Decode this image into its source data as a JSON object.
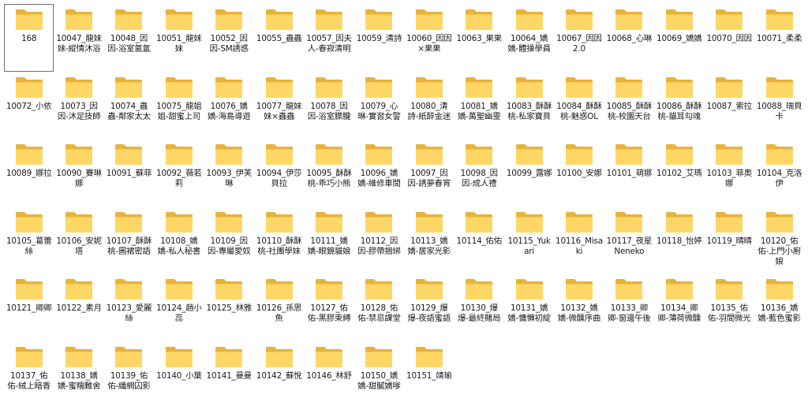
{
  "folder_icon": {
    "name": "folder-icon",
    "back_color": "#E8B33A",
    "front_color": "#FFD767",
    "edge_color": "#F7C64F"
  },
  "selected_index": 0,
  "folders": [
    {
      "label": "168"
    },
    {
      "label": "10047_龍妹妹-縱情沐浴"
    },
    {
      "label": "10048_因因-浴室氤氲"
    },
    {
      "label": "10051_龍妹妹"
    },
    {
      "label": "10052_因因-SM誘惑"
    },
    {
      "label": "10055_蟲蟲"
    },
    {
      "label": "10057_因夫人-春寂清明"
    },
    {
      "label": "10059_清詩"
    },
    {
      "label": "10060_因因×果果"
    },
    {
      "label": "10063_果果"
    },
    {
      "label": "10064_嬌嬌-體操學員"
    },
    {
      "label": "10067_因因2.0"
    },
    {
      "label": "10068_心琳"
    },
    {
      "label": "10069_嬌嬌"
    },
    {
      "label": "10070_因因"
    },
    {
      "label": "10071_柔柔"
    },
    {
      "label": "10072_小依"
    },
    {
      "label": "10073_因因-沐足技師"
    },
    {
      "label": "10074_蟲蟲-鄰家太太"
    },
    {
      "label": "10075_龍姐姐-甜蜜上司"
    },
    {
      "label": "10076_嬌嬌-海島導遊"
    },
    {
      "label": "10077_龍妹妹×蟲蟲"
    },
    {
      "label": "10078_因因-浴室朦朧"
    },
    {
      "label": "10079_心琳-實習女警"
    },
    {
      "label": "10080_清詩-紙醉金迷"
    },
    {
      "label": "10081_嬌嬌-萬聖幽靈"
    },
    {
      "label": "10083_酥酥桃-私家寶貝"
    },
    {
      "label": "10084_酥酥桃-魅惑OL"
    },
    {
      "label": "10085_酥酥桃-校園天台"
    },
    {
      "label": "10086_酥酥桃-貓耳勾魂"
    },
    {
      "label": "10087_索拉"
    },
    {
      "label": "10088_瑞貝卡"
    },
    {
      "label": "10089_娜拉"
    },
    {
      "label": "10090_賽琳娜"
    },
    {
      "label": "10091_蘇菲"
    },
    {
      "label": "10092_薇若莉"
    },
    {
      "label": "10093_伊芙琳"
    },
    {
      "label": "10094_伊莎貝拉"
    },
    {
      "label": "10095_酥酥桃-乖巧小熊"
    },
    {
      "label": "10096_嬌嬌-維修車間"
    },
    {
      "label": "10097_因因-誘夢春宵"
    },
    {
      "label": "10098_因因-成人禮"
    },
    {
      "label": "10099_露娜"
    },
    {
      "label": "10100_安娜"
    },
    {
      "label": "10101_萌娜"
    },
    {
      "label": "10102_艾瑪"
    },
    {
      "label": "10103_菲奧娜"
    },
    {
      "label": "10104_克洛伊"
    },
    {
      "label": "10105_葛蕾絲"
    },
    {
      "label": "10106_安妮塔"
    },
    {
      "label": "10107_酥酥桃-圖裙密語"
    },
    {
      "label": "10108_嬌嬌-私人秘書"
    },
    {
      "label": "10109_因因-專屬愛奴"
    },
    {
      "label": "10110_酥酥桃-社團學妹"
    },
    {
      "label": "10111_嬌嬌-眼鏡貓娘"
    },
    {
      "label": "10112_因因-膠帶捆綁"
    },
    {
      "label": "10113_嬌嬌-居家光影"
    },
    {
      "label": "10114_佑佑"
    },
    {
      "label": "10115_Yukari"
    },
    {
      "label": "10116_Misaki"
    },
    {
      "label": "10117_夜星Neneko"
    },
    {
      "label": "10118_怡婷"
    },
    {
      "label": "10119_晴晴"
    },
    {
      "label": "10120_佑佑-上門小廚娘"
    },
    {
      "label": "10121_卿卿"
    },
    {
      "label": "10122_素月"
    },
    {
      "label": "10123_愛麗絲"
    },
    {
      "label": "10124_趙小蕊"
    },
    {
      "label": "10125_林雅"
    },
    {
      "label": "10126_孫思魚"
    },
    {
      "label": "10127_佑佑-黑膠束縛"
    },
    {
      "label": "10128_佑佑-禁忌課堂"
    },
    {
      "label": "10129_爆爆-夜語蜜語"
    },
    {
      "label": "10130_爆爆-最終賭局"
    },
    {
      "label": "10131_嬌嬌-慵懶初綻"
    },
    {
      "label": "10132_嬌嬌-微醺序曲"
    },
    {
      "label": "10133_卿卿-窗邊午後"
    },
    {
      "label": "10134_卿卿-薄荷微醺"
    },
    {
      "label": "10135_佑佑-羽間微光"
    },
    {
      "label": "10136_嬌嬌-藍色蜜影"
    },
    {
      "label": "10137_佑佑-絨上暗香"
    },
    {
      "label": "10138_嬌嬌-蜜糯難舍"
    },
    {
      "label": "10139_佑佑-纖網囚影"
    },
    {
      "label": "10140_小葉"
    },
    {
      "label": "10141_曼曼"
    },
    {
      "label": "10142_蘇悅"
    },
    {
      "label": "10146_林舒"
    },
    {
      "label": "10150_嬌嬌-甜膩嬌嗲"
    },
    {
      "label": "10151_靖瑜"
    }
  ]
}
